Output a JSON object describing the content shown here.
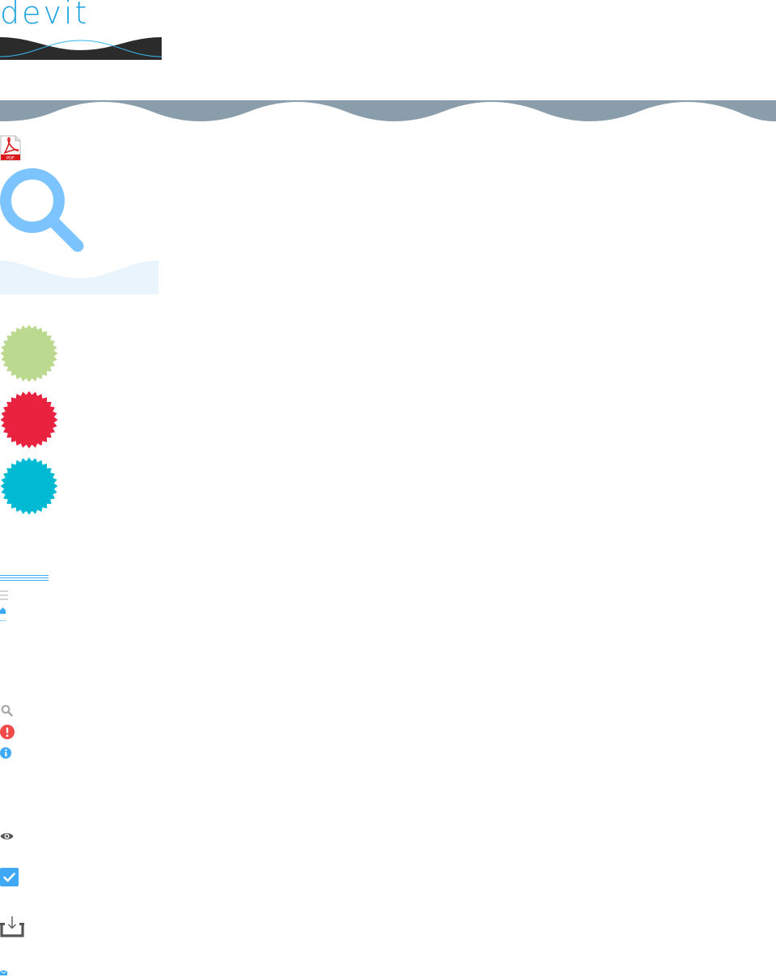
{
  "brand": {
    "logo_text": "devit",
    "logo_color": "#1ba3e0",
    "wave_dark": "#2b2b2b",
    "wave_line": "#39b6ec"
  },
  "colors": {
    "banner": "#8a9daa",
    "pdf_red": "#d9191c",
    "search_blue": "#7cc4ff",
    "light_wave": "#eaf4fd",
    "star_green": "#bbd98f",
    "star_red": "#e8223f",
    "star_teal": "#00b9d3",
    "ui_blue": "#3fa9f5",
    "ui_gray": "#a7a9ab",
    "alert_red": "#f04a4a",
    "dark_gray": "#555555"
  },
  "icons": [
    "pdf-icon",
    "magnifier-icon",
    "starburst-badge-icon",
    "hamburger-icon",
    "home-icon",
    "search-icon",
    "alert-icon",
    "info-icon",
    "eye-icon",
    "checkbox-icon",
    "download-icon",
    "mail-icon"
  ],
  "pdf_label": "PDF"
}
